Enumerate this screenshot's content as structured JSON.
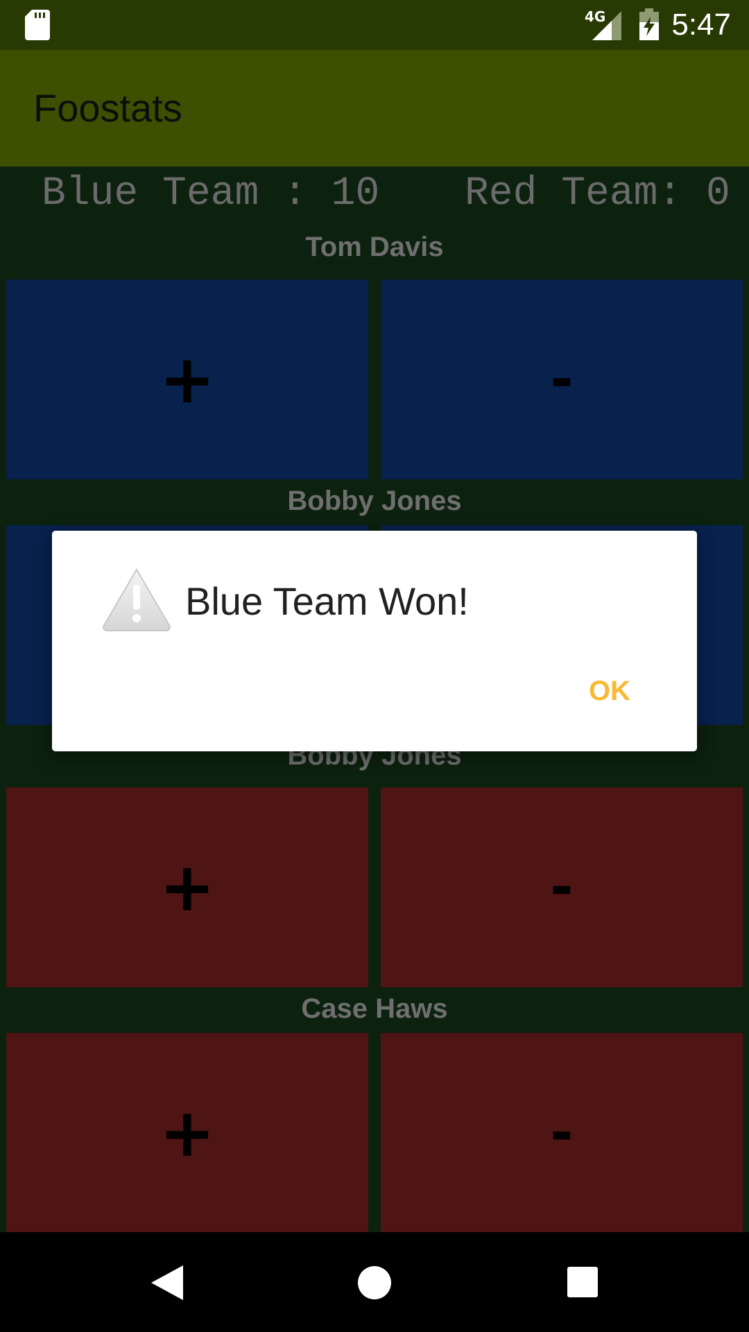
{
  "status_bar": {
    "time": "5:47",
    "network": "4G",
    "icons": [
      "sd-card-icon",
      "cell-signal-icon",
      "battery-charging-icon"
    ]
  },
  "app": {
    "title": "Foostats"
  },
  "scores": {
    "blue": "Blue Team : 10",
    "red": "Red Team: 0"
  },
  "players": [
    {
      "name": "Tom Davis",
      "team": "blue",
      "plus_label": "+",
      "minus_label": "-"
    },
    {
      "name": "Bobby Jones",
      "team": "blue",
      "plus_label": "+",
      "minus_label": "-"
    },
    {
      "name": "Bobby Jones",
      "team": "red",
      "plus_label": "+",
      "minus_label": "-"
    },
    {
      "name": "Case Haws",
      "team": "red",
      "plus_label": "+",
      "minus_label": "-"
    }
  ],
  "dialog": {
    "icon": "warning-icon",
    "title": "Blue Team Won!",
    "ok_label": "OK"
  },
  "colors": {
    "status_bar": "#283a03",
    "app_bar": "#3d5001",
    "background": "#0c210e",
    "blue_button": "#08214d",
    "red_button": "#4f1414",
    "dialog_accent": "#f9b932"
  },
  "nav_bar": {
    "icons": [
      "back-icon",
      "home-icon",
      "recents-icon"
    ]
  }
}
